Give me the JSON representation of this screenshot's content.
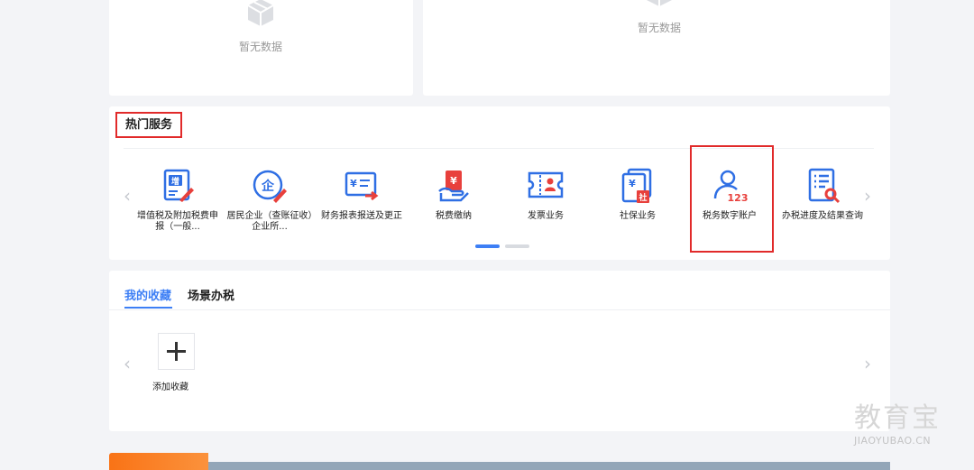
{
  "empty_state": {
    "left_text": "暂无数据",
    "right_text": "暂无数据"
  },
  "hot_services": {
    "title": "热门服务",
    "items": [
      {
        "label": "增值税及附加税费申报（一般...",
        "icon": "vat-declaration-icon"
      },
      {
        "label": "居民企业（查账征收）企业所...",
        "icon": "enterprise-tax-icon"
      },
      {
        "label": "财务报表报送及更正",
        "icon": "financial-report-icon"
      },
      {
        "label": "税费缴纳",
        "icon": "tax-payment-icon"
      },
      {
        "label": "发票业务",
        "icon": "invoice-icon"
      },
      {
        "label": "社保业务",
        "icon": "social-security-icon"
      },
      {
        "label": "税务数字账户",
        "icon": "digital-account-icon"
      },
      {
        "label": "办税进度及结果查询",
        "icon": "progress-query-icon"
      }
    ],
    "pagination": {
      "pages": 2,
      "current": 1
    }
  },
  "favorites": {
    "tabs": [
      {
        "label": "我的收藏",
        "active": true
      },
      {
        "label": "场景办税",
        "active": false
      }
    ],
    "add_label": "添加收藏"
  },
  "watermark": {
    "cn": "教育宝",
    "en": "JIAOYUBAO.CN"
  },
  "colors": {
    "accent": "#3d7ff5",
    "highlight": "#e12a2a",
    "icon_blue": "#2f6fe4",
    "icon_red": "#e8403c"
  }
}
